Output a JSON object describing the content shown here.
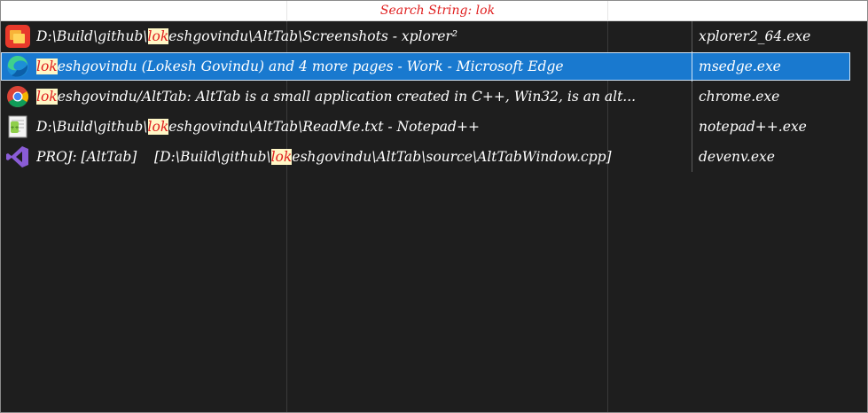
{
  "header": {
    "search_label": "Search String: lok"
  },
  "rows": [
    {
      "icon": "xplorer2-icon",
      "title_prefix": "D:\\Build\\github\\",
      "title_match": "lok",
      "title_suffix": "eshgovindu\\AltTab\\Screenshots - xplorer²",
      "process": "xplorer2_64.exe",
      "selected": false
    },
    {
      "icon": "edge-icon",
      "title_prefix": "",
      "title_match": "lok",
      "title_suffix": "eshgovindu (Lokesh Govindu) and 4 more pages - Work - Microsoft Edge",
      "process": "msedge.exe",
      "selected": true
    },
    {
      "icon": "chrome-icon",
      "title_prefix": "",
      "title_match": "lok",
      "title_suffix": "eshgovindu/AltTab: AltTab is a small application created in C++, Win32, is an alt...",
      "process": "chrome.exe",
      "selected": false
    },
    {
      "icon": "notepadpp-icon",
      "title_prefix": "D:\\Build\\github\\",
      "title_match": "lok",
      "title_suffix": "eshgovindu\\AltTab\\ReadMe.txt - Notepad++",
      "process": "notepad++.exe",
      "selected": false
    },
    {
      "icon": "visual-studio-icon",
      "title_prefix": "PROJ: [AltTab]    [D:\\Build\\github\\",
      "title_match": "lok",
      "title_suffix": "eshgovindu\\AltTab\\source\\AltTabWindow.cpp]",
      "process": "devenv.exe",
      "selected": false
    }
  ],
  "colors": {
    "background": "#1e1e1e",
    "selection": "#1979cf",
    "match_text": "#e02020",
    "match_background": "#fff7c6"
  }
}
